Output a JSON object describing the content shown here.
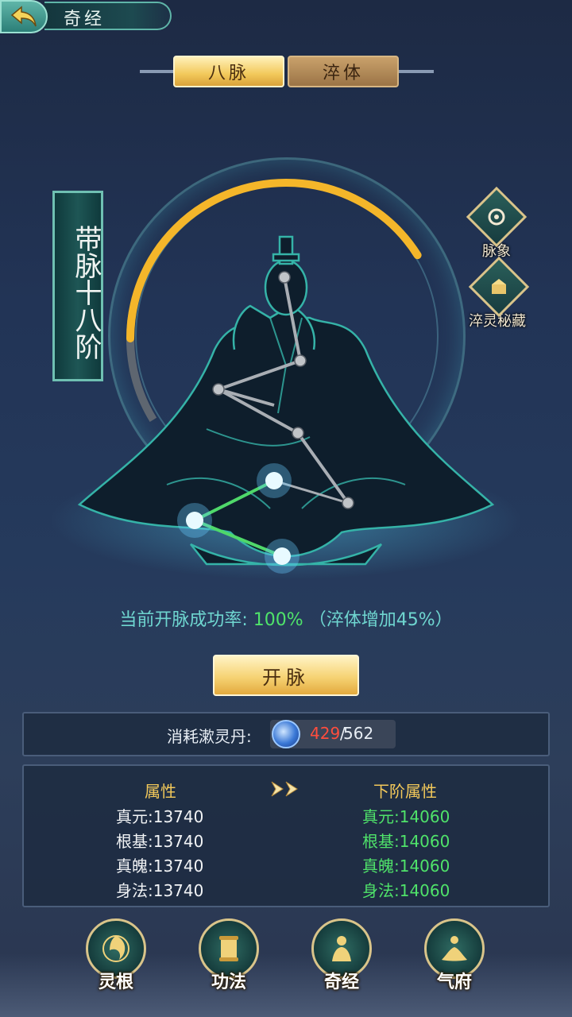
{
  "header": {
    "title": "奇经"
  },
  "tabs": [
    {
      "label": "八脉",
      "active": true
    },
    {
      "label": "淬体",
      "active": false
    }
  ],
  "rank": {
    "text": "带脉十八阶"
  },
  "side_buttons": [
    {
      "label": "脉象",
      "icon": "vein-pattern-icon"
    },
    {
      "label": "淬灵秘藏",
      "icon": "treasure-chest-icon"
    }
  ],
  "rate": {
    "label": "当前开脉成功率:",
    "value": "100%",
    "note": "（淬体增加45%）"
  },
  "open_button": {
    "label": "开脉"
  },
  "cost": {
    "label": "消耗漱灵丹:",
    "have": "429",
    "sep": "/",
    "total": "562"
  },
  "attributes": {
    "current_header": "属性",
    "next_header": "下阶属性",
    "current": [
      "真元:13740",
      "根基:13740",
      "真魄:13740",
      "身法:13740"
    ],
    "next": [
      "真元:14060",
      "根基:14060",
      "真魄:14060",
      "身法:14060"
    ]
  },
  "progress": {
    "ring_fill_fraction": 0.82
  },
  "nav": [
    {
      "label": "灵根",
      "icon": "spirit-root-icon"
    },
    {
      "label": "功法",
      "icon": "scroll-icon"
    },
    {
      "label": "奇经",
      "icon": "meridian-icon"
    },
    {
      "label": "气府",
      "icon": "meditation-icon"
    }
  ],
  "colors": {
    "accent_gold": "#f2c85a",
    "success_green": "#4fe36a",
    "teal": "#6fd6d0",
    "warn_red": "#ff4d3d"
  }
}
